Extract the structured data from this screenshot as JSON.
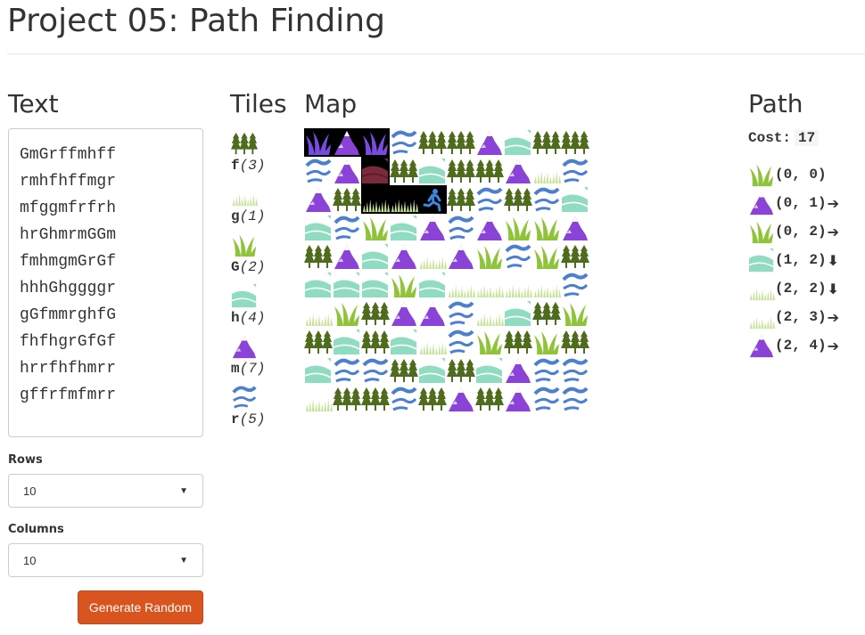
{
  "header": {
    "title": "Project 05: Path Finding"
  },
  "text_panel": {
    "heading": "Text",
    "map_text": "GmGrffmhff\nrmhfhffmgr\nmfggmfrfrh\nhrGhmrmGGm\nfmhmgmGrGf\nhhhGhggggr\ngGfmmrghfG\nfhfhgrGfGf\nhrrfhfhmrr\ngffrfmfmrr"
  },
  "controls": {
    "rows_label": "Rows",
    "rows_value": "10",
    "columns_label": "Columns",
    "columns_value": "10",
    "generate_button": "Generate Random"
  },
  "tiles": {
    "heading": "Tiles",
    "items": [
      {
        "key": "f",
        "cost": "(3)",
        "icon": "forest-icon"
      },
      {
        "key": "g",
        "cost": "(1)",
        "icon": "light-grass-icon"
      },
      {
        "key": "G",
        "cost": "(2)",
        "icon": "tall-grass-icon"
      },
      {
        "key": "h",
        "cost": "(4)",
        "icon": "hills-icon"
      },
      {
        "key": "m",
        "cost": "(7)",
        "icon": "mountain-icon"
      },
      {
        "key": "r",
        "cost": "(5)",
        "icon": "river-icon"
      }
    ]
  },
  "map": {
    "heading": "Map",
    "rows": [
      "GmGrffmhff",
      "rmhfhffmgr",
      "mfggmfrfrh",
      "hrGhmrmGGm",
      "fmhmgmGrGf",
      "hhhGhggggr",
      "gGfmmrghfG",
      "fhfhgrGfGf",
      "hrrfhfhmrr",
      "gffrfmfmrr"
    ],
    "highlighted_cells": [
      [
        0,
        0
      ],
      [
        0,
        1
      ],
      [
        0,
        2
      ],
      [
        1,
        2
      ],
      [
        2,
        2
      ],
      [
        2,
        3
      ],
      [
        2,
        4
      ]
    ],
    "runner_cell": [
      2,
      4
    ],
    "runner_icon": "runner-icon"
  },
  "path": {
    "heading": "Path",
    "cost_label": "Cost:",
    "cost_value": "17",
    "steps": [
      {
        "tile": "G",
        "coord": "(0, 0)",
        "arrow": ""
      },
      {
        "tile": "m",
        "coord": "(0, 1)",
        "arrow": "🡒"
      },
      {
        "tile": "G",
        "coord": "(0, 2)",
        "arrow": "🡒"
      },
      {
        "tile": "h",
        "coord": "(1, 2)",
        "arrow": "🡓"
      },
      {
        "tile": "g",
        "coord": "(2, 2)",
        "arrow": "🡓"
      },
      {
        "tile": "g",
        "coord": "(2, 3)",
        "arrow": "🡒"
      },
      {
        "tile": "m",
        "coord": "(2, 4)",
        "arrow": "🡒"
      }
    ]
  },
  "colors": {
    "forest": "#4f6b1c",
    "light_grass": "#c6e39a",
    "tall_grass": "#8fc43a",
    "hills": "#8fdcc0",
    "mountain": "#8a43d6",
    "river": "#4a7fd1",
    "accent_button": "#d9541f"
  }
}
